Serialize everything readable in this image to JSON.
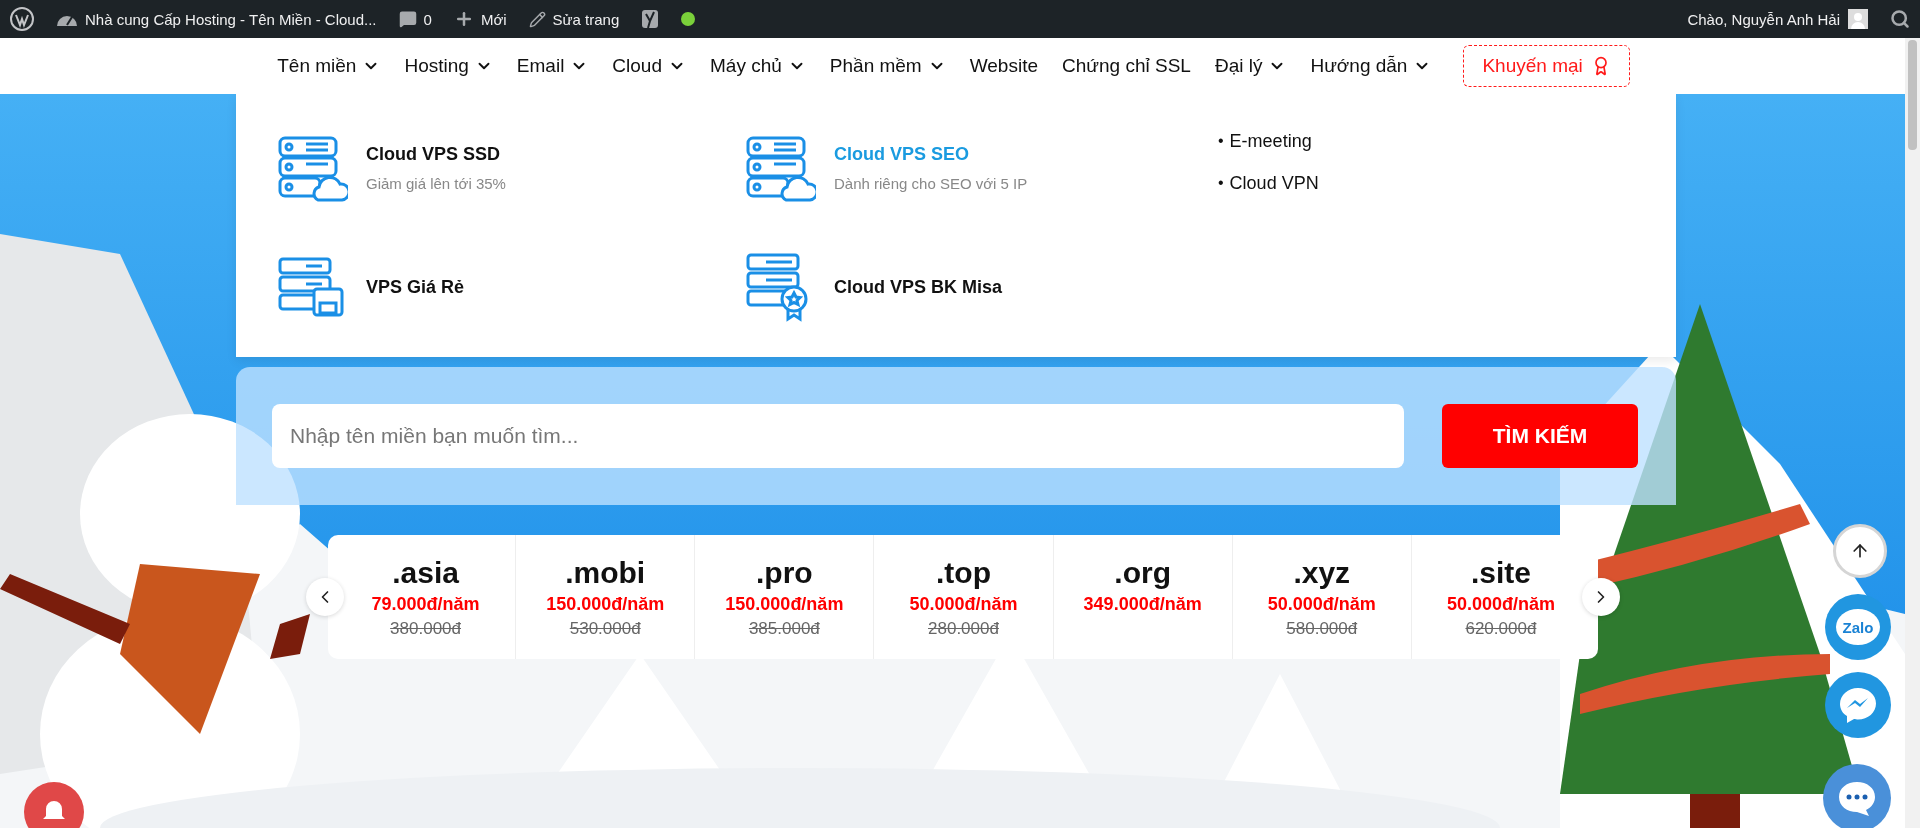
{
  "admin_bar": {
    "site_title": "Nhà cung Cấp Hosting - Tên Miền - Cloud...",
    "comments": "0",
    "new_label": "Mới",
    "edit_label": "Sửa trang",
    "greeting": "Chào, Nguyễn Anh Hải"
  },
  "nav": {
    "items": [
      {
        "label": "Tên miền",
        "dropdown": true
      },
      {
        "label": "Hosting",
        "dropdown": true
      },
      {
        "label": "Email",
        "dropdown": true
      },
      {
        "label": "Cloud",
        "dropdown": true
      },
      {
        "label": "Máy chủ",
        "dropdown": true
      },
      {
        "label": "Phần mềm",
        "dropdown": true
      },
      {
        "label": "Website",
        "dropdown": false
      },
      {
        "label": "Chứng chỉ SSL",
        "dropdown": false
      },
      {
        "label": "Đại lý",
        "dropdown": true
      },
      {
        "label": "Hướng dẫn",
        "dropdown": true
      }
    ],
    "promo": "Khuyến mại"
  },
  "mega_menu": {
    "products": [
      {
        "title": "Cloud VPS SSD",
        "subtitle": "Giảm giá lên tới 35%",
        "highlighted": false
      },
      {
        "title": "Cloud VPS SEO",
        "subtitle": "Dành riêng cho SEO với 5 IP",
        "highlighted": true
      },
      {
        "title": "VPS Giá Rẻ",
        "highlighted": false
      },
      {
        "title": "Cloud VPS BK Misa",
        "highlighted": false
      }
    ],
    "links": [
      {
        "bullet": "•",
        "label": "E-meeting"
      },
      {
        "bullet": "•",
        "label": "Cloud VPN"
      }
    ]
  },
  "search": {
    "placeholder": "Nhập tên miền bạn muốn tìm...",
    "button": "TÌM KIẾM"
  },
  "domains": [
    {
      "tld": ".asia",
      "price": "79.000đ/năm",
      "old_price": "380.000đ"
    },
    {
      "tld": ".mobi",
      "price": "150.000đ/năm",
      "old_price": "530.000đ"
    },
    {
      "tld": ".pro",
      "price": "150.000đ/năm",
      "old_price": "385.000đ"
    },
    {
      "tld": ".top",
      "price": "50.000đ/năm",
      "old_price": "280.000đ"
    },
    {
      "tld": ".org",
      "price": "349.000đ/năm"
    },
    {
      "tld": ".xyz",
      "price": "50.000đ/năm",
      "old_price": "580.000đ"
    },
    {
      "tld": ".site",
      "price": "50.000đ/năm",
      "old_price": "620.000đ"
    }
  ],
  "floating": {
    "zalo": "Zalo"
  }
}
